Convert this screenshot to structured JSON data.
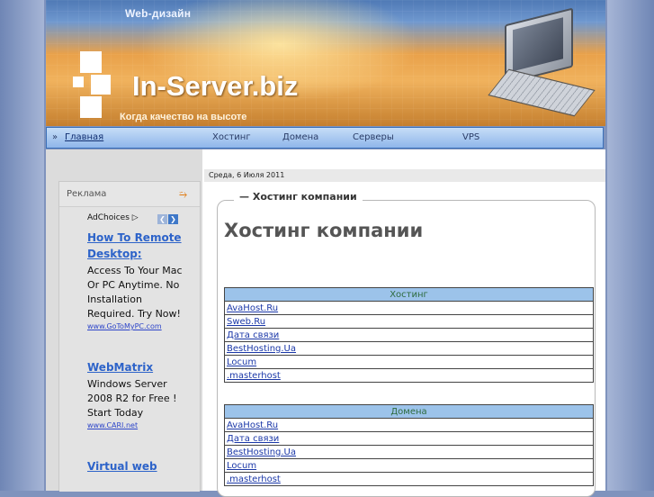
{
  "header": {
    "web_title": "Web-дизайн",
    "logo": "In-Server.biz",
    "slogan": "Когда качество на высоте"
  },
  "nav": {
    "prefix": "»",
    "items": [
      {
        "label": "Главная",
        "active": true
      },
      {
        "label": "Хостинг"
      },
      {
        "label": "Домена"
      },
      {
        "label": "Серверы"
      },
      {
        "label": "VPS"
      }
    ]
  },
  "date": "Среда, 6 Июля 2011",
  "ads": {
    "header": "Реклама",
    "adchoices": "AdChoices",
    "items": [
      {
        "title": "How To Remote Desktop:",
        "text": "Access To Your Mac Or PC Anytime. No Installation Required. Try Now!",
        "url": "www.GoToMyPC.com"
      },
      {
        "title": "WebMatrix",
        "text": "Windows Server 2008 R2 for Free ! Start Today",
        "url": "www.CARI.net"
      },
      {
        "title": "Virtual web",
        "text": "",
        "url": ""
      }
    ]
  },
  "content": {
    "legend": "Хостинг компании",
    "heading": "Хостинг компании",
    "tables": [
      {
        "header": "Хостинг",
        "rows": [
          "AvaHost.Ru",
          "Sweb.Ru",
          "Дата связи",
          "BestHosting.Ua",
          "Locum",
          ".masterhost"
        ]
      },
      {
        "header": "Домена",
        "rows": [
          "AvaHost.Ru",
          "Дата связи",
          "BestHosting.Ua",
          "Locum",
          ".masterhost"
        ]
      }
    ]
  },
  "colors": {
    "nav_bg": "#a9c9f1",
    "link": "#1b38a8",
    "ad_title": "#2d63c9",
    "table_header": "#9cc3ea"
  }
}
